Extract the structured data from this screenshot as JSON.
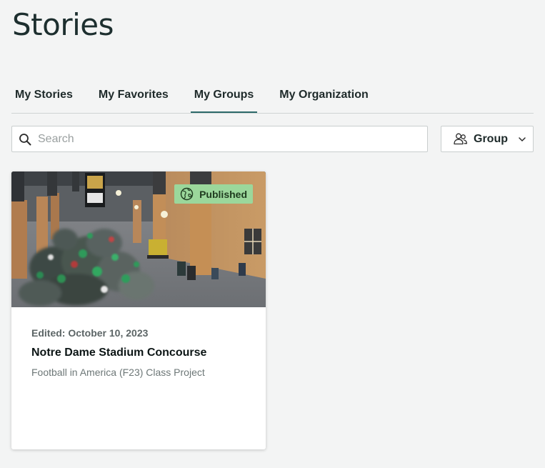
{
  "page": {
    "title": "Stories"
  },
  "tabs": [
    {
      "label": "My Stories",
      "active": false
    },
    {
      "label": "My Favorites",
      "active": false
    },
    {
      "label": "My Groups",
      "active": true
    },
    {
      "label": "My Organization",
      "active": false
    }
  ],
  "search": {
    "placeholder": "Search",
    "value": "",
    "icon": "search-icon"
  },
  "filter": {
    "label": "Group",
    "icon": "group-icon",
    "dropdown_icon": "chevron-down-icon"
  },
  "stories": [
    {
      "status": "Published",
      "status_icon": "globe-icon",
      "status_color": "#9bd79b",
      "edited": "Edited: October 10, 2023",
      "title": "Notre Dame Stadium Concourse",
      "subtitle": "Football in America (F23) Class Project",
      "thumbnail": "stadium-concourse-photo"
    }
  ],
  "colors": {
    "background": "#f3f4f4",
    "active_tab_underline": "#2d6b6b",
    "badge_green": "#9bd79b"
  }
}
